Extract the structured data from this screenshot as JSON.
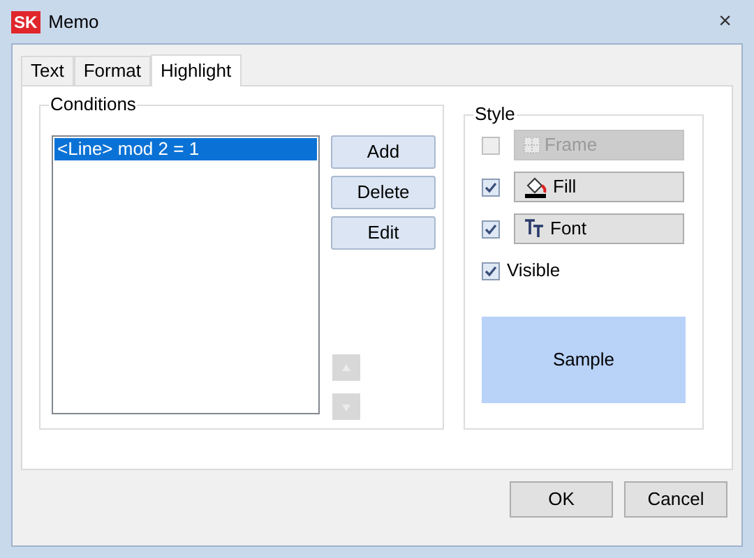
{
  "window": {
    "title": "Memo",
    "logo": "SK",
    "close": "×"
  },
  "tabs": [
    {
      "label": "Text",
      "selected": false
    },
    {
      "label": "Format",
      "selected": false
    },
    {
      "label": "Highlight",
      "selected": true
    }
  ],
  "conditions": {
    "title": "Conditions",
    "items": [
      {
        "label": "<Line> mod 2 = 1",
        "selected": true
      }
    ],
    "buttons": [
      "Add",
      "Delete",
      "Edit"
    ],
    "move_buttons": [
      {
        "kind": "up",
        "disabled": true
      },
      {
        "kind": "down",
        "disabled": true
      }
    ]
  },
  "style": {
    "title": "Style",
    "options": [
      {
        "kind": "button",
        "label": "Frame",
        "checked": false,
        "disabled": true
      },
      {
        "kind": "button",
        "label": "Fill",
        "checked": true,
        "disabled": false
      },
      {
        "kind": "button",
        "label": "Font",
        "checked": true,
        "disabled": false
      },
      {
        "kind": "checkbox",
        "label": "Visible",
        "checked": true,
        "disabled": false
      }
    ],
    "sample": "Sample"
  },
  "footer": {
    "buttons": [
      "OK",
      "Cancel"
    ]
  }
}
